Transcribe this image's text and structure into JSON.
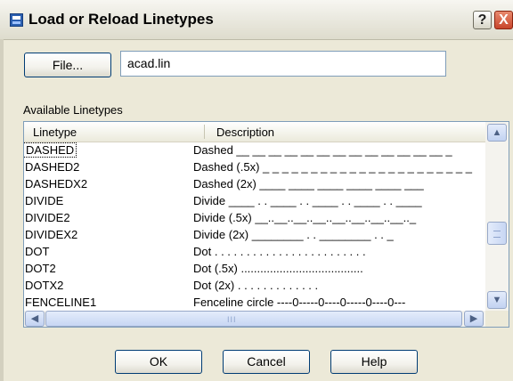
{
  "window": {
    "title": "Load or Reload Linetypes",
    "help_glyph": "?",
    "close_glyph": "X"
  },
  "file": {
    "button_label": "File...",
    "value": "acad.lin"
  },
  "list": {
    "label": "Available Linetypes",
    "columns": [
      "Linetype",
      "Description"
    ],
    "rows": [
      {
        "name": "DASHED",
        "description": "Dashed __ __ __ __ __ __ __ __ __ __ __ __ __ _",
        "selected": true
      },
      {
        "name": "DASHED2",
        "description": "Dashed (.5x) _ _ _ _ _ _ _ _ _ _ _ _ _ _ _ _ _ _ _ _ _ _"
      },
      {
        "name": "DASHEDX2",
        "description": "Dashed (2x) ____  ____  ____  ____  ____  ___"
      },
      {
        "name": "DIVIDE",
        "description": "Divide ____ . . ____ . . ____ . . ____ . . ____"
      },
      {
        "name": "DIVIDE2",
        "description": "Divide (.5x) __..__..__..__..__..__..__..__.._"
      },
      {
        "name": "DIVIDEX2",
        "description": "Divide (2x) ________  .  .  ________  .  .  _"
      },
      {
        "name": "DOT",
        "description": "Dot . . . . . . . . . . . . . . . . . . . . . . . ."
      },
      {
        "name": "DOT2",
        "description": "Dot (.5x) ......................................"
      },
      {
        "name": "DOTX2",
        "description": "Dot (2x) .  .  .  .  .  .  .  .  .  .  .  .  ."
      },
      {
        "name": "FENCELINE1",
        "description": "Fenceline circle ----0-----0----0-----0----0---"
      }
    ]
  },
  "scrollbar": {
    "up": "▲",
    "down": "▼",
    "left": "◀",
    "right": "▶",
    "grip": "III"
  },
  "buttons": {
    "ok": "OK",
    "cancel": "Cancel",
    "help": "Help"
  }
}
